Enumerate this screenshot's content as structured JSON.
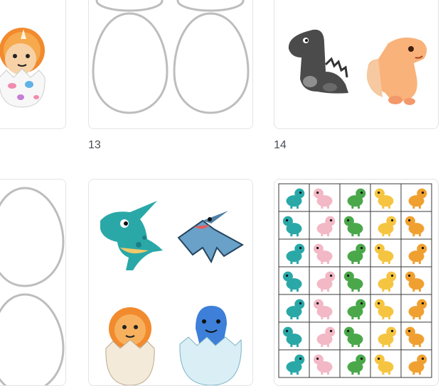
{
  "pages": [
    {
      "id": "page-12-partial",
      "label": ""
    },
    {
      "id": "page-13",
      "label": "13"
    },
    {
      "id": "page-14",
      "label": "14"
    }
  ],
  "thumbnails": {
    "page_13_label": "13",
    "page_14_label": "14"
  },
  "icons": {
    "dino_colors": [
      "#2aa8a8",
      "#e04040",
      "#4aa84a",
      "#3d7fd9",
      "#f0a030",
      "#8a6cc9",
      "#4a4a4a",
      "#f2b8c6",
      "#8cc63f",
      "#f5c542",
      "#ff8a50",
      "#66c2e0"
    ]
  }
}
